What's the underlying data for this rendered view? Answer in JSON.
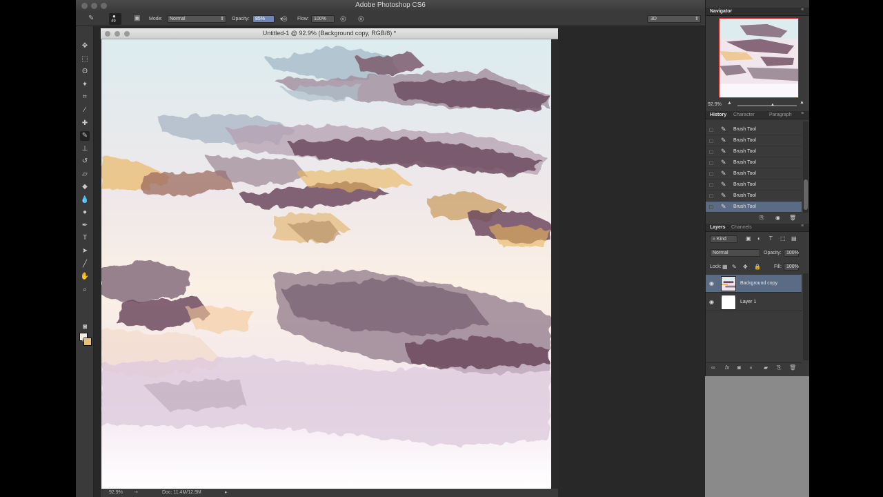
{
  "app": {
    "title": "Adobe Photoshop CS6"
  },
  "options": {
    "brush_size": "49",
    "mode_label": "Mode:",
    "mode_value": "Normal",
    "opacity_label": "Opacity:",
    "opacity_value": "85%",
    "flow_label": "Flow:",
    "flow_value": "100%",
    "workspace": "3D"
  },
  "document": {
    "title": "Untitled-1 @ 92.9% (Background copy, RGB/8) *",
    "zoom": "92.9%",
    "doc_size": "Doc: 11.4M/12.9M"
  },
  "navigator": {
    "tab": "Navigator",
    "zoom": "92.9%"
  },
  "history": {
    "tabs": [
      "History",
      "Character",
      "Paragraph"
    ],
    "items": [
      "Brush Tool",
      "Brush Tool",
      "Brush Tool",
      "Brush Tool",
      "Brush Tool",
      "Brush Tool",
      "Brush Tool",
      "Brush Tool"
    ],
    "selected_index": 7
  },
  "layers": {
    "tabs": [
      "Layers",
      "Channels"
    ],
    "filter": "Kind",
    "blend_mode": "Normal",
    "opacity_label": "Opacity:",
    "opacity_value": "100%",
    "lock_label": "Lock:",
    "fill_label": "Fill:",
    "fill_value": "100%",
    "items": [
      {
        "name": "Background copy",
        "selected": true
      },
      {
        "name": "Layer 1",
        "selected": false
      }
    ]
  },
  "colors": {
    "foreground": "#f4eee0",
    "background": "#e8c070",
    "selection": "#5a6b86"
  }
}
